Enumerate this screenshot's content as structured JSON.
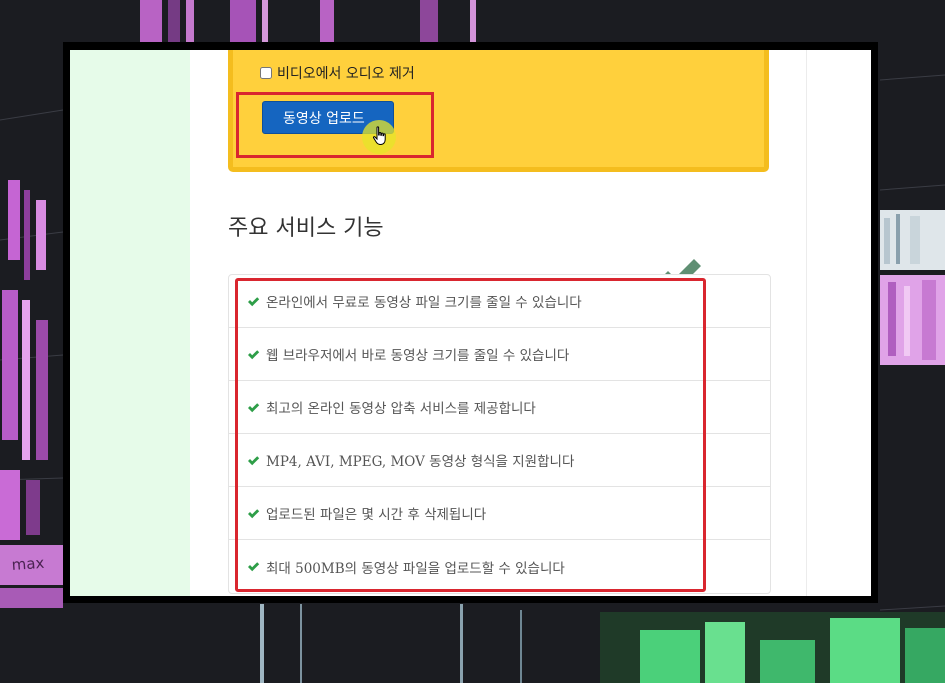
{
  "upload": {
    "remove_audio_label": "비디오에서 오디오 제거",
    "remove_audio_checked": false,
    "upload_button_label": "동영상 업로드"
  },
  "features": {
    "title": "주요 서비스 기능",
    "items": [
      {
        "text": "온라인에서 무료로 동영상 파일 크기를 줄일 수 있습니다"
      },
      {
        "text": "웹 브라우저에서 바로 동영상 크기를 줄일 수 있습니다"
      },
      {
        "text": "최고의 온라인 동영상 압축 서비스를 제공합니다"
      },
      {
        "text": "MP4, AVI, MPEG, MOV 동영상 형식을 지원합니다"
      },
      {
        "text": "업로드된 파일은 몇 시간 후 삭제됩니다"
      },
      {
        "text": "최대 500MB의 동영상 파일을 업로드할 수 있습니다"
      }
    ]
  },
  "background": {
    "timeline_label": "max"
  },
  "colors": {
    "card_bg": "#ffd03c",
    "button_bg": "#1565c0",
    "highlight_red": "#d9262f",
    "check_green": "#2e9e48",
    "left_strip": "#e6fbe9"
  }
}
